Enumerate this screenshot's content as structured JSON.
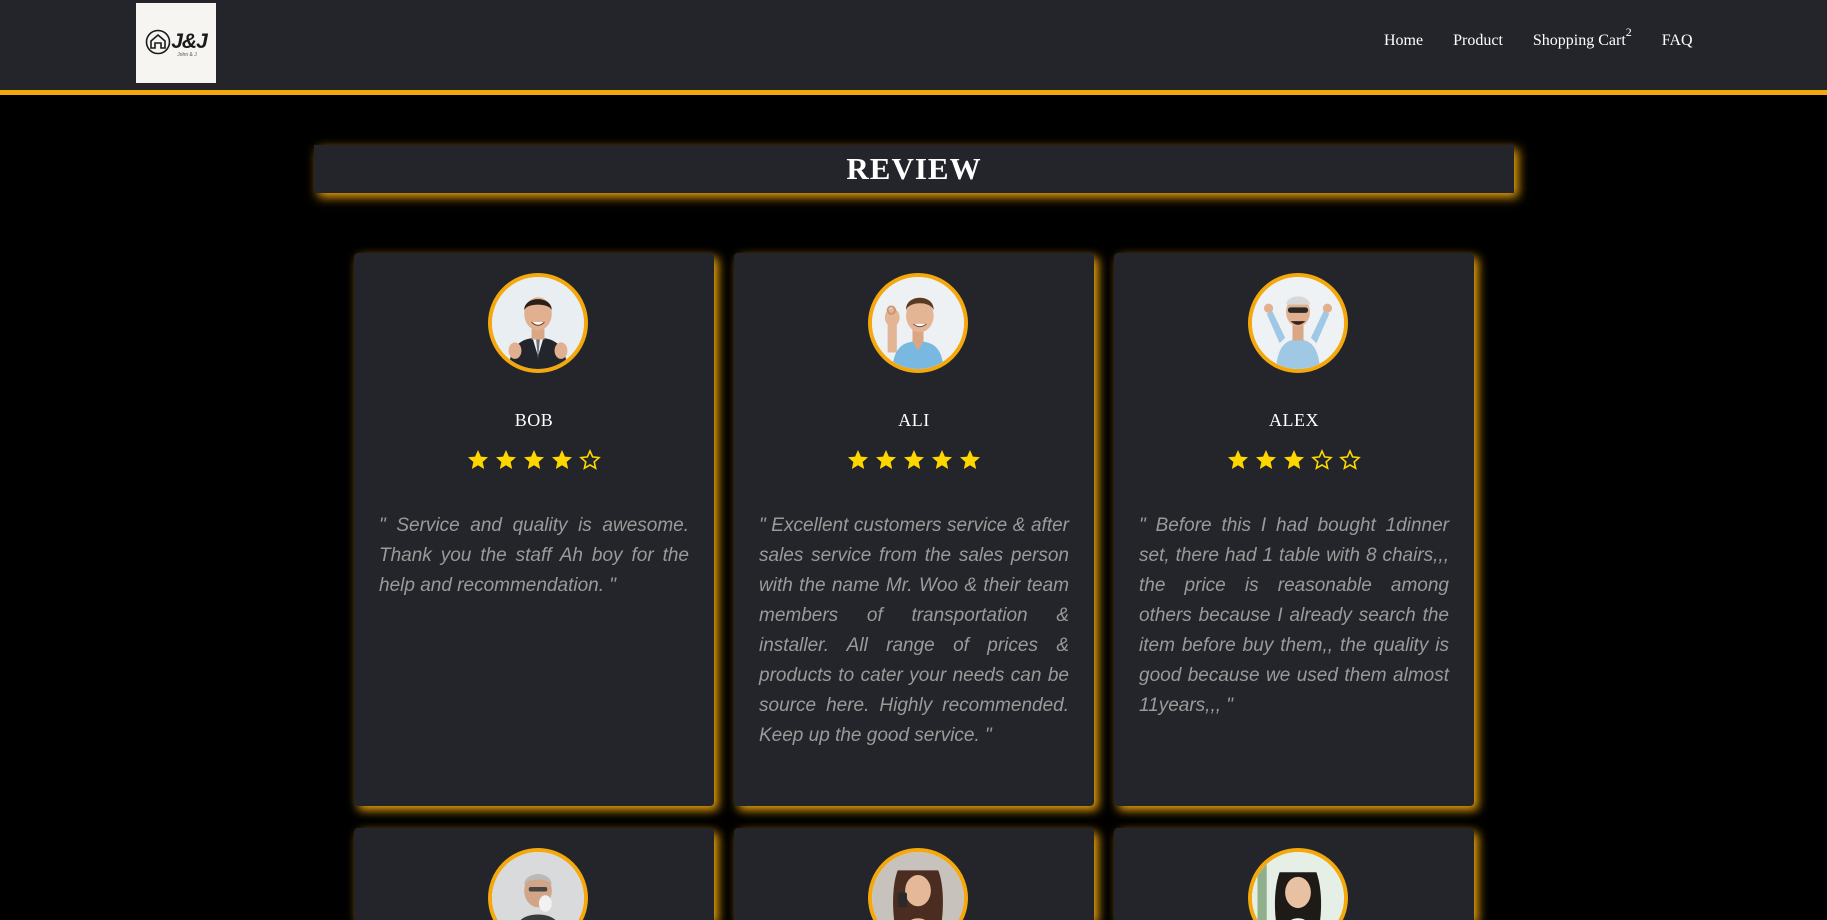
{
  "navbar": {
    "logo_text": "J&J",
    "logo_sub": "John & J",
    "links": [
      {
        "label": "Home"
      },
      {
        "label": "Product"
      },
      {
        "label": "Shopping Cart",
        "badge": "2"
      },
      {
        "label": "FAQ"
      }
    ]
  },
  "colors": {
    "accent": "#f4a80c",
    "card_bg": "#24252a",
    "star": "#ffd700"
  },
  "review": {
    "title": "REVIEW",
    "cards": [
      {
        "name": "BOB",
        "rating": 4,
        "max_rating": 5,
        "text": "\" Service and quality is awesome. Thank you the staff Ah boy for the help and recommendation. \""
      },
      {
        "name": "ALI",
        "rating": 5,
        "max_rating": 5,
        "text": "\" Excellent customers service & after sales service from the sales person with the name Mr. Woo & their team members of transportation & installer. All range of prices & products to cater your needs can be source here. Highly recommended. Keep up the good service. \""
      },
      {
        "name": "ALEX",
        "rating": 3,
        "max_rating": 5,
        "text": "\" Before this I had bought 1dinner set, there had 1 table with 8 chairs,,, the price is reasonable among others because I already search the item before buy them,, the quality is good because we used them almost 11years,,, \""
      },
      {
        "name": "",
        "rating": null,
        "text": ""
      },
      {
        "name": "",
        "rating": null,
        "text": ""
      },
      {
        "name": "",
        "rating": null,
        "text": ""
      }
    ]
  }
}
